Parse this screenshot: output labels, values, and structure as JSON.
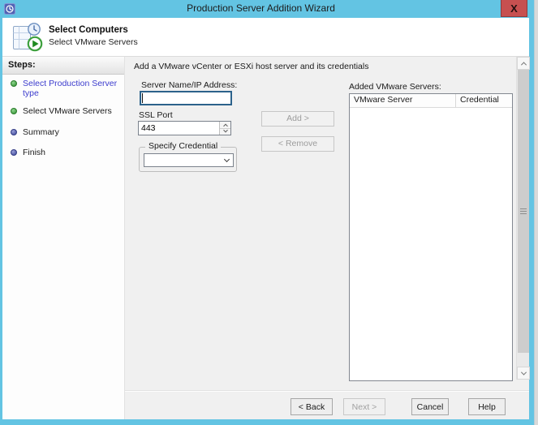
{
  "window": {
    "title": "Production Server Addition Wizard",
    "close_glyph": "X"
  },
  "header": {
    "title": "Select Computers",
    "subtitle": "Select VMware Servers"
  },
  "sidebar": {
    "title": "Steps:",
    "items": [
      {
        "label": "Select Production Server type",
        "status": "completed",
        "bullet": "green"
      },
      {
        "label": "Select VMware Servers",
        "status": "current",
        "bullet": "green"
      },
      {
        "label": "Summary",
        "status": "pending",
        "bullet": "purple"
      },
      {
        "label": "Finish",
        "status": "pending",
        "bullet": "purple"
      }
    ]
  },
  "content": {
    "instruction": "Add a VMware vCenter or ESXi host server and its credentials",
    "server_name": {
      "label": "Server Name/IP Address:",
      "value": "",
      "placeholder": ""
    },
    "ssl_port": {
      "label": "SSL Port",
      "value": "443"
    },
    "credential": {
      "group_label": "Specify Credential",
      "selected_value": ""
    },
    "buttons": {
      "add": "Add >",
      "remove": "< Remove"
    },
    "added_servers": {
      "label": "Added VMware Servers:",
      "columns": [
        "VMware Server",
        "Credential"
      ],
      "rows": []
    }
  },
  "footer": {
    "back": "< Back",
    "next": "Next >",
    "cancel": "Cancel",
    "help": "Help"
  },
  "colors": {
    "frame": "#63c4e3",
    "close_button": "#c75050",
    "link_text": "#3c3ccd",
    "bullet_completed": "#43a943",
    "bullet_pending": "#4d55a6",
    "focus_border": "#2c628b"
  }
}
